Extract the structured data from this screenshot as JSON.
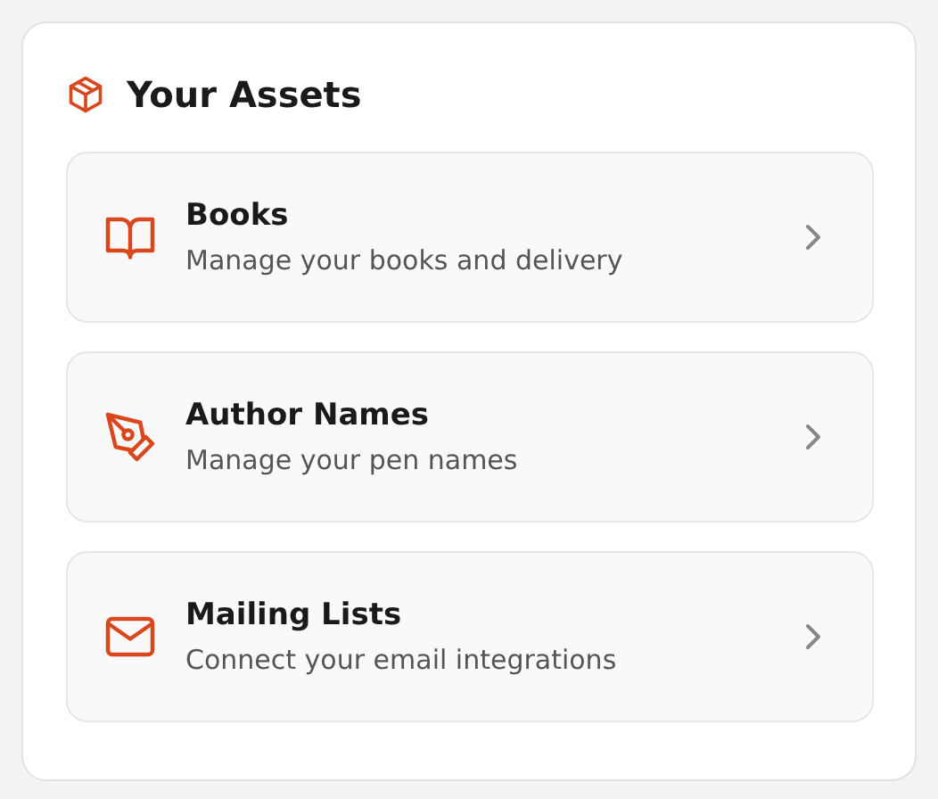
{
  "card": {
    "title": "Your Assets"
  },
  "items": [
    {
      "title": "Books",
      "subtitle": "Manage your books and delivery"
    },
    {
      "title": "Author Names",
      "subtitle": "Manage your pen names"
    },
    {
      "title": "Mailing Lists",
      "subtitle": "Connect your email integrations"
    }
  ]
}
